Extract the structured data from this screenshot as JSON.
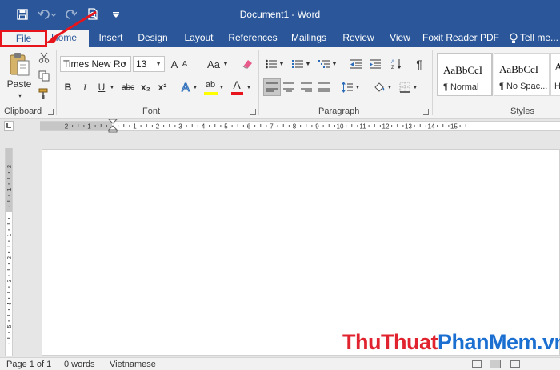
{
  "window": {
    "title": "Document1 - Word"
  },
  "qat": {
    "icons": [
      "save-icon",
      "undo-icon",
      "redo-icon",
      "print-preview-icon",
      "customize-qat-icon"
    ]
  },
  "tabs": [
    {
      "label": "File"
    },
    {
      "label": "Home"
    },
    {
      "label": "Insert"
    },
    {
      "label": "Design"
    },
    {
      "label": "Layout"
    },
    {
      "label": "References"
    },
    {
      "label": "Mailings"
    },
    {
      "label": "Review"
    },
    {
      "label": "View"
    },
    {
      "label": "Foxit Reader PDF"
    },
    {
      "label": "Tell me..."
    }
  ],
  "ribbon": {
    "clipboard": {
      "label": "Clipboard",
      "paste_label": "Paste"
    },
    "font": {
      "label": "Font",
      "font_name": "Times New Ro",
      "font_size": "13",
      "grow_label": "A",
      "shrink_label": "A",
      "case_label": "Aa",
      "bold_label": "B",
      "italic_label": "I",
      "underline_label": "U",
      "strike_label": "abc",
      "subscript_label": "x₂",
      "superscript_label": "x²",
      "effects_label": "A",
      "highlight_label": "ab",
      "font_color_label": "A",
      "highlight_color": "#ffff00",
      "font_color": "#e8141c"
    },
    "paragraph": {
      "label": "Paragraph",
      "pilcrow": "¶"
    },
    "styles": {
      "label": "Styles",
      "items": [
        {
          "sample": "AaBbCcI",
          "name": "¶ Normal"
        },
        {
          "sample": "AaBbCcI",
          "name": "¶ No Spac..."
        },
        {
          "sample": "A",
          "name": "H"
        }
      ]
    }
  },
  "ruler": {
    "numbers": [
      "2",
      "1",
      "1",
      "2",
      "3",
      "4",
      "5",
      "6",
      "7",
      "8",
      "9",
      "10",
      "11",
      "12",
      "13",
      "14",
      "15"
    ],
    "vertical_numbers": [
      "2",
      "1",
      "1",
      "2",
      "3",
      "4",
      "5"
    ]
  },
  "status": {
    "page": "Page 1 of 1",
    "words": "0 words",
    "language": "Vietnamese"
  },
  "watermark": {
    "part1": "Thu",
    "part2": "Thuat",
    "part3": "PhanMem",
    "part4": ".vn"
  },
  "colors": {
    "brand_blue": "#2b579a",
    "ribbon_bg": "#f3f3f3",
    "annotation_red": "#e8141c",
    "watermark_red": "#e0232e",
    "watermark_blue": "#1b6fd1"
  }
}
